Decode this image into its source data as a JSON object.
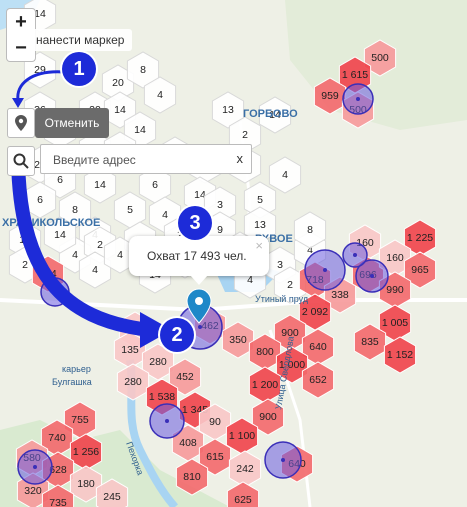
{
  "controls": {
    "zoom_in": "+",
    "zoom_out": "−",
    "marker_hint": "нанести маркер",
    "cancel_label": "Отменить",
    "search_placeholder": "Введите адрес",
    "search_clear": "x"
  },
  "popup": {
    "text": "Охват 17 493 чел.",
    "close": "×"
  },
  "steps": [
    "1",
    "2",
    "3"
  ],
  "places": {
    "gorbovo": "ГОРБОВО",
    "hrenikolskoe": "ХРАНИКОЛЬСКОЕ",
    "nikolo": "…РХВОЕ",
    "pond": "Утиный пруд",
    "quarry_1": "карьер",
    "quarry_2": "Булгашка",
    "street_1": "Пехорка",
    "street_2": "Улица Свердлова"
  },
  "colors": {
    "accent_blue": "#1d2bd8",
    "pin_blue": "#1e88c8",
    "circle_purple": "#6a5be0"
  },
  "hexes_white": [
    "14",
    "29",
    "20",
    "8",
    "20",
    "14",
    "13",
    "36",
    "4",
    "14",
    "5",
    "14",
    "2",
    "26",
    "14",
    "2",
    "9",
    "20",
    "6",
    "14",
    "6",
    "14",
    "13",
    "3",
    "5",
    "4",
    "6",
    "8",
    "5",
    "4",
    "9",
    "4",
    "4",
    "4",
    "2",
    "14",
    "13",
    "4",
    "13",
    "4",
    "3",
    "4",
    "4",
    "14",
    "4",
    "2",
    "8",
    "13",
    "2",
    "2"
  ],
  "hexes_red": [
    "500",
    "1 615",
    "959",
    "500",
    "160",
    "1 225",
    "718",
    "696",
    "160",
    "965",
    "338",
    "990",
    "2 092",
    "1 005",
    "774",
    "900",
    "835",
    "1 152",
    "135",
    "462",
    "350",
    "640",
    "135",
    "800",
    "1 000",
    "280",
    "452",
    "652",
    "280",
    "1 200",
    "1 538",
    "1 345",
    "900",
    "755",
    "90",
    "740",
    "1 256",
    "408",
    "1 100",
    "580",
    "628",
    "615",
    "242",
    "640",
    "320",
    "180",
    "810",
    "735",
    "245",
    "625"
  ]
}
